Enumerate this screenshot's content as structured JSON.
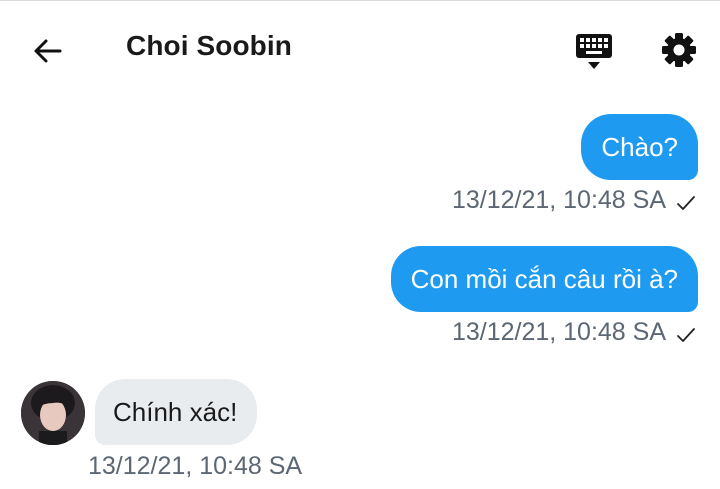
{
  "header": {
    "title": "Choi Soobin",
    "back_icon": "arrow-left-icon",
    "keyboard_icon": "keyboard-hide-icon",
    "settings_icon": "gear-icon"
  },
  "messages": [
    {
      "direction": "outgoing",
      "text": "Chào?",
      "timestamp": "13/12/21, 10:48 SA",
      "status_icon": "check-icon"
    },
    {
      "direction": "outgoing",
      "text": "Con mồi cắn câu rồi à?",
      "timestamp": "13/12/21, 10:48 SA",
      "status_icon": "check-icon"
    },
    {
      "direction": "incoming",
      "text": "Chính xác!",
      "timestamp": "13/12/21, 10:48 SA",
      "avatar": "contact-avatar"
    }
  ],
  "colors": {
    "outgoing_bubble": "#1e9bf0",
    "incoming_bubble": "#e9ecef",
    "timestamp": "#5c6773"
  }
}
